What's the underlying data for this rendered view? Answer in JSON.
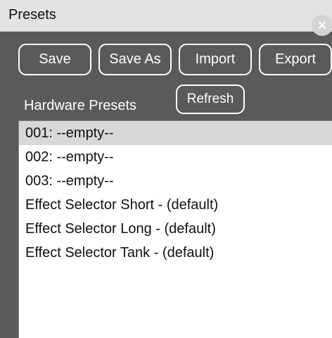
{
  "window": {
    "title": "Presets",
    "close_glyph": "×"
  },
  "toolbar": {
    "save_label": "Save",
    "save_as_label": "Save As",
    "import_label": "Import",
    "export_label": "Export"
  },
  "hardware": {
    "section_label": "Hardware Presets",
    "refresh_label": "Refresh",
    "selected_index": 0,
    "items": [
      "001: --empty--",
      "002: --empty--",
      "003: --empty--",
      "Effect Selector Short - (default)",
      "Effect Selector Long - (default)",
      "Effect Selector Tank - (default)"
    ]
  },
  "colors": {
    "panel_bg": "#5a5a5a",
    "title_bar_bg": "#e3e3e3",
    "button_border": "#ffffff",
    "selected_row_bg": "#d8d8d8"
  },
  "icons": {
    "close": "close-icon"
  }
}
